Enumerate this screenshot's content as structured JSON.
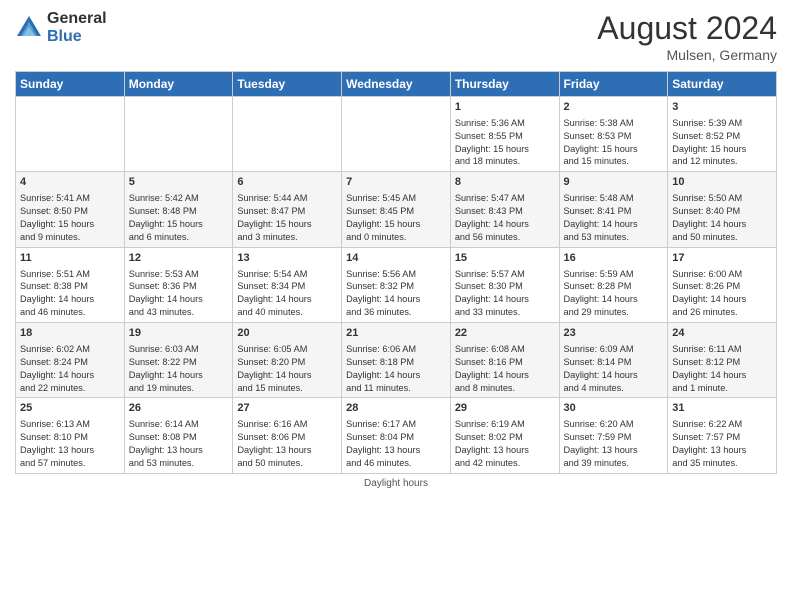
{
  "header": {
    "logo_general": "General",
    "logo_blue": "Blue",
    "month_year": "August 2024",
    "location": "Mulsen, Germany"
  },
  "weekdays": [
    "Sunday",
    "Monday",
    "Tuesday",
    "Wednesday",
    "Thursday",
    "Friday",
    "Saturday"
  ],
  "weeks": [
    [
      {
        "day": "",
        "info": ""
      },
      {
        "day": "",
        "info": ""
      },
      {
        "day": "",
        "info": ""
      },
      {
        "day": "",
        "info": ""
      },
      {
        "day": "1",
        "info": "Sunrise: 5:36 AM\nSunset: 8:55 PM\nDaylight: 15 hours\nand 18 minutes."
      },
      {
        "day": "2",
        "info": "Sunrise: 5:38 AM\nSunset: 8:53 PM\nDaylight: 15 hours\nand 15 minutes."
      },
      {
        "day": "3",
        "info": "Sunrise: 5:39 AM\nSunset: 8:52 PM\nDaylight: 15 hours\nand 12 minutes."
      }
    ],
    [
      {
        "day": "4",
        "info": "Sunrise: 5:41 AM\nSunset: 8:50 PM\nDaylight: 15 hours\nand 9 minutes."
      },
      {
        "day": "5",
        "info": "Sunrise: 5:42 AM\nSunset: 8:48 PM\nDaylight: 15 hours\nand 6 minutes."
      },
      {
        "day": "6",
        "info": "Sunrise: 5:44 AM\nSunset: 8:47 PM\nDaylight: 15 hours\nand 3 minutes."
      },
      {
        "day": "7",
        "info": "Sunrise: 5:45 AM\nSunset: 8:45 PM\nDaylight: 15 hours\nand 0 minutes."
      },
      {
        "day": "8",
        "info": "Sunrise: 5:47 AM\nSunset: 8:43 PM\nDaylight: 14 hours\nand 56 minutes."
      },
      {
        "day": "9",
        "info": "Sunrise: 5:48 AM\nSunset: 8:41 PM\nDaylight: 14 hours\nand 53 minutes."
      },
      {
        "day": "10",
        "info": "Sunrise: 5:50 AM\nSunset: 8:40 PM\nDaylight: 14 hours\nand 50 minutes."
      }
    ],
    [
      {
        "day": "11",
        "info": "Sunrise: 5:51 AM\nSunset: 8:38 PM\nDaylight: 14 hours\nand 46 minutes."
      },
      {
        "day": "12",
        "info": "Sunrise: 5:53 AM\nSunset: 8:36 PM\nDaylight: 14 hours\nand 43 minutes."
      },
      {
        "day": "13",
        "info": "Sunrise: 5:54 AM\nSunset: 8:34 PM\nDaylight: 14 hours\nand 40 minutes."
      },
      {
        "day": "14",
        "info": "Sunrise: 5:56 AM\nSunset: 8:32 PM\nDaylight: 14 hours\nand 36 minutes."
      },
      {
        "day": "15",
        "info": "Sunrise: 5:57 AM\nSunset: 8:30 PM\nDaylight: 14 hours\nand 33 minutes."
      },
      {
        "day": "16",
        "info": "Sunrise: 5:59 AM\nSunset: 8:28 PM\nDaylight: 14 hours\nand 29 minutes."
      },
      {
        "day": "17",
        "info": "Sunrise: 6:00 AM\nSunset: 8:26 PM\nDaylight: 14 hours\nand 26 minutes."
      }
    ],
    [
      {
        "day": "18",
        "info": "Sunrise: 6:02 AM\nSunset: 8:24 PM\nDaylight: 14 hours\nand 22 minutes."
      },
      {
        "day": "19",
        "info": "Sunrise: 6:03 AM\nSunset: 8:22 PM\nDaylight: 14 hours\nand 19 minutes."
      },
      {
        "day": "20",
        "info": "Sunrise: 6:05 AM\nSunset: 8:20 PM\nDaylight: 14 hours\nand 15 minutes."
      },
      {
        "day": "21",
        "info": "Sunrise: 6:06 AM\nSunset: 8:18 PM\nDaylight: 14 hours\nand 11 minutes."
      },
      {
        "day": "22",
        "info": "Sunrise: 6:08 AM\nSunset: 8:16 PM\nDaylight: 14 hours\nand 8 minutes."
      },
      {
        "day": "23",
        "info": "Sunrise: 6:09 AM\nSunset: 8:14 PM\nDaylight: 14 hours\nand 4 minutes."
      },
      {
        "day": "24",
        "info": "Sunrise: 6:11 AM\nSunset: 8:12 PM\nDaylight: 14 hours\nand 1 minute."
      }
    ],
    [
      {
        "day": "25",
        "info": "Sunrise: 6:13 AM\nSunset: 8:10 PM\nDaylight: 13 hours\nand 57 minutes."
      },
      {
        "day": "26",
        "info": "Sunrise: 6:14 AM\nSunset: 8:08 PM\nDaylight: 13 hours\nand 53 minutes."
      },
      {
        "day": "27",
        "info": "Sunrise: 6:16 AM\nSunset: 8:06 PM\nDaylight: 13 hours\nand 50 minutes."
      },
      {
        "day": "28",
        "info": "Sunrise: 6:17 AM\nSunset: 8:04 PM\nDaylight: 13 hours\nand 46 minutes."
      },
      {
        "day": "29",
        "info": "Sunrise: 6:19 AM\nSunset: 8:02 PM\nDaylight: 13 hours\nand 42 minutes."
      },
      {
        "day": "30",
        "info": "Sunrise: 6:20 AM\nSunset: 7:59 PM\nDaylight: 13 hours\nand 39 minutes."
      },
      {
        "day": "31",
        "info": "Sunrise: 6:22 AM\nSunset: 7:57 PM\nDaylight: 13 hours\nand 35 minutes."
      }
    ]
  ],
  "footer": "Daylight hours"
}
